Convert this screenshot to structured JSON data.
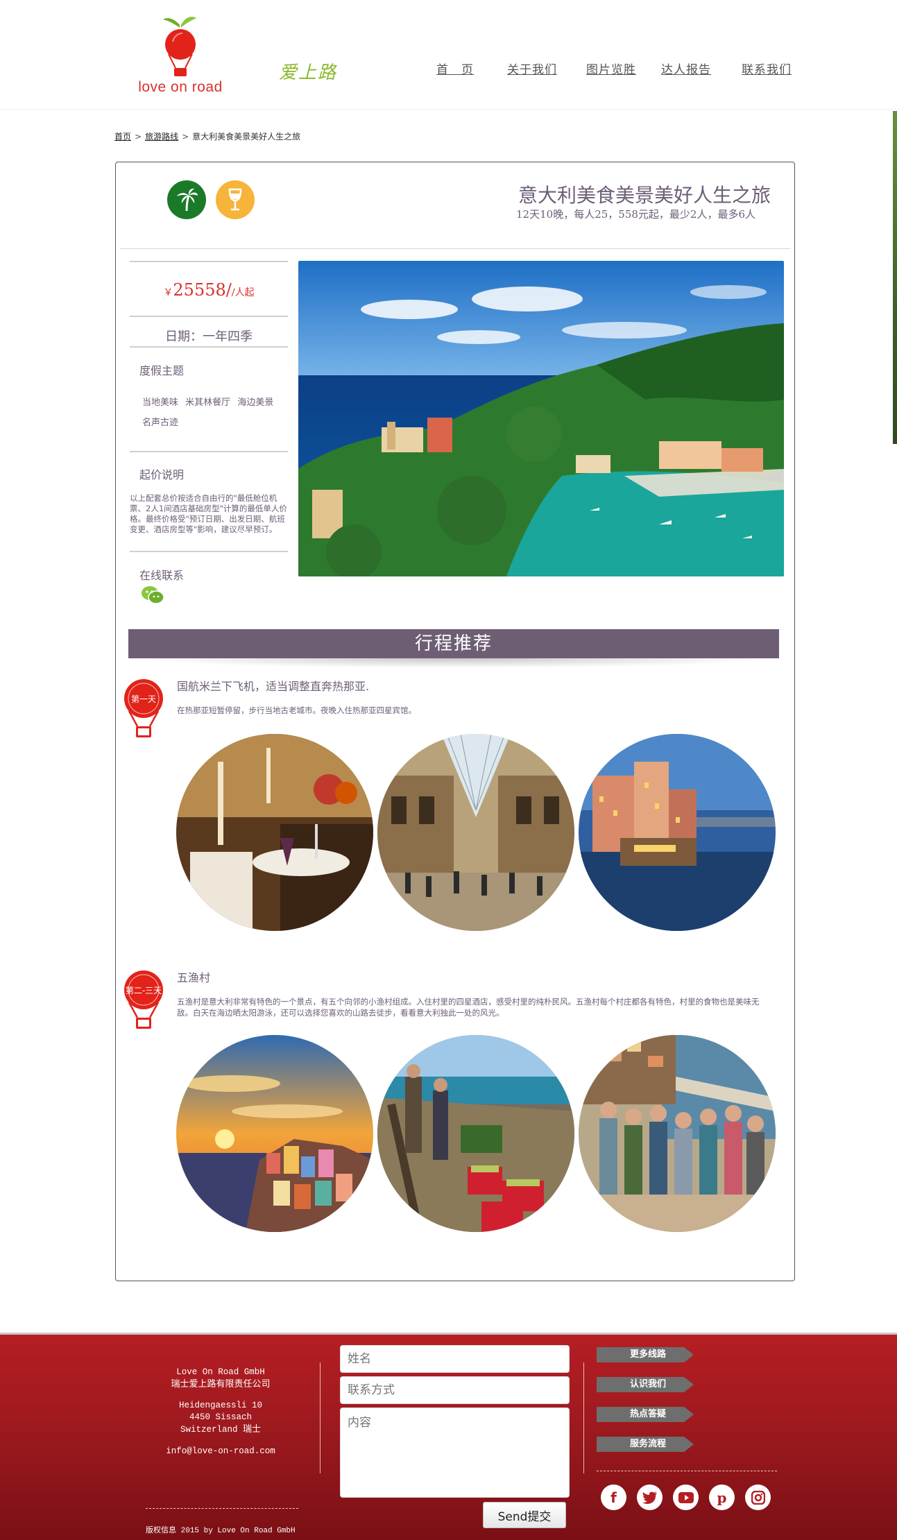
{
  "header": {
    "logo_text": "love on road",
    "slogan": "爱上路",
    "nav": [
      "首　页",
      "关于我们",
      "图片览胜",
      "达人报告",
      "联系我们"
    ]
  },
  "breadcrumb": {
    "home": "首页",
    "category": "旅游路线",
    "current": "意大利美食美景美好人生之旅"
  },
  "trip": {
    "title": "意大利美食美景美好人生之旅",
    "subtitle": "12天10晚，每人25，558元起，最少2人，最多6人",
    "price_currency": "￥",
    "price_value": "25558",
    "price_unit": "/人起",
    "date": "日期：一年四季",
    "theme_title": "度假主题",
    "themes": [
      "当地美味",
      "米其林餐厅",
      "海边美景",
      "名声古迹"
    ],
    "price_note_title": "起价说明",
    "price_note": "以上配套总价按适合自由行的\"最低舱位机票、2人1间酒店基础房型\"计算的最低单人价格。最终价格受\"预订日期、出发日期、航班变更、酒店房型等\"影响，建议尽早预订。",
    "contact_title": "在线联系",
    "icons": [
      "palm-tree-icon",
      "wine-glass-icon",
      "wechat-icon"
    ]
  },
  "itinerary": {
    "banner": "行程推荐",
    "days": [
      {
        "badge": "第一天",
        "title": "国航米兰下飞机，适当调整直奔热那亚.",
        "desc": "在热那亚短暂停留，步行当地古老城市。夜晚入住热那亚四星宾馆。"
      },
      {
        "badge": "第二-三天",
        "title": "五渔村",
        "desc": "五渔村是意大利非常有特色的一个景点，有五个向邻的小渔村组成。入住村里的四星酒店，感受村里的纯朴民风。五渔村每个村庄都各有特色，村里的食物也是美味无敌。白天在海边晒太阳游泳，还可以选择您喜欢的山路去徒步，看看意大利独此一处的风光。"
      }
    ]
  },
  "footer": {
    "company_en": "Love On Road GmbH",
    "company_cn": "瑞士爱上路有限责任公司",
    "street": "Heidengaessli 10",
    "city": "4450 Sissach",
    "country_en": "Switzerland",
    "country_cn": "瑞士",
    "email": "info@love-on-road.com",
    "copyright_cn": "版权信息",
    "copyright_en": "2015 by Love On Road GmbH",
    "form": {
      "name_placeholder": "姓名",
      "contact_placeholder": "联系方式",
      "content_placeholder": "内容",
      "send": "Send提交"
    },
    "links": [
      "更多线路",
      "认识我们",
      "热点答疑",
      "服务流程"
    ],
    "social": [
      "facebook-icon",
      "twitter-icon",
      "youtube-icon",
      "pinterest-icon",
      "instagram-icon"
    ]
  },
  "colors": {
    "brand_red": "#d8312d",
    "theme_purple": "#6e5e74",
    "footer_red": "#a01a1f",
    "palm_green": "#1b7a28",
    "wine_orange": "#f6b43a"
  }
}
